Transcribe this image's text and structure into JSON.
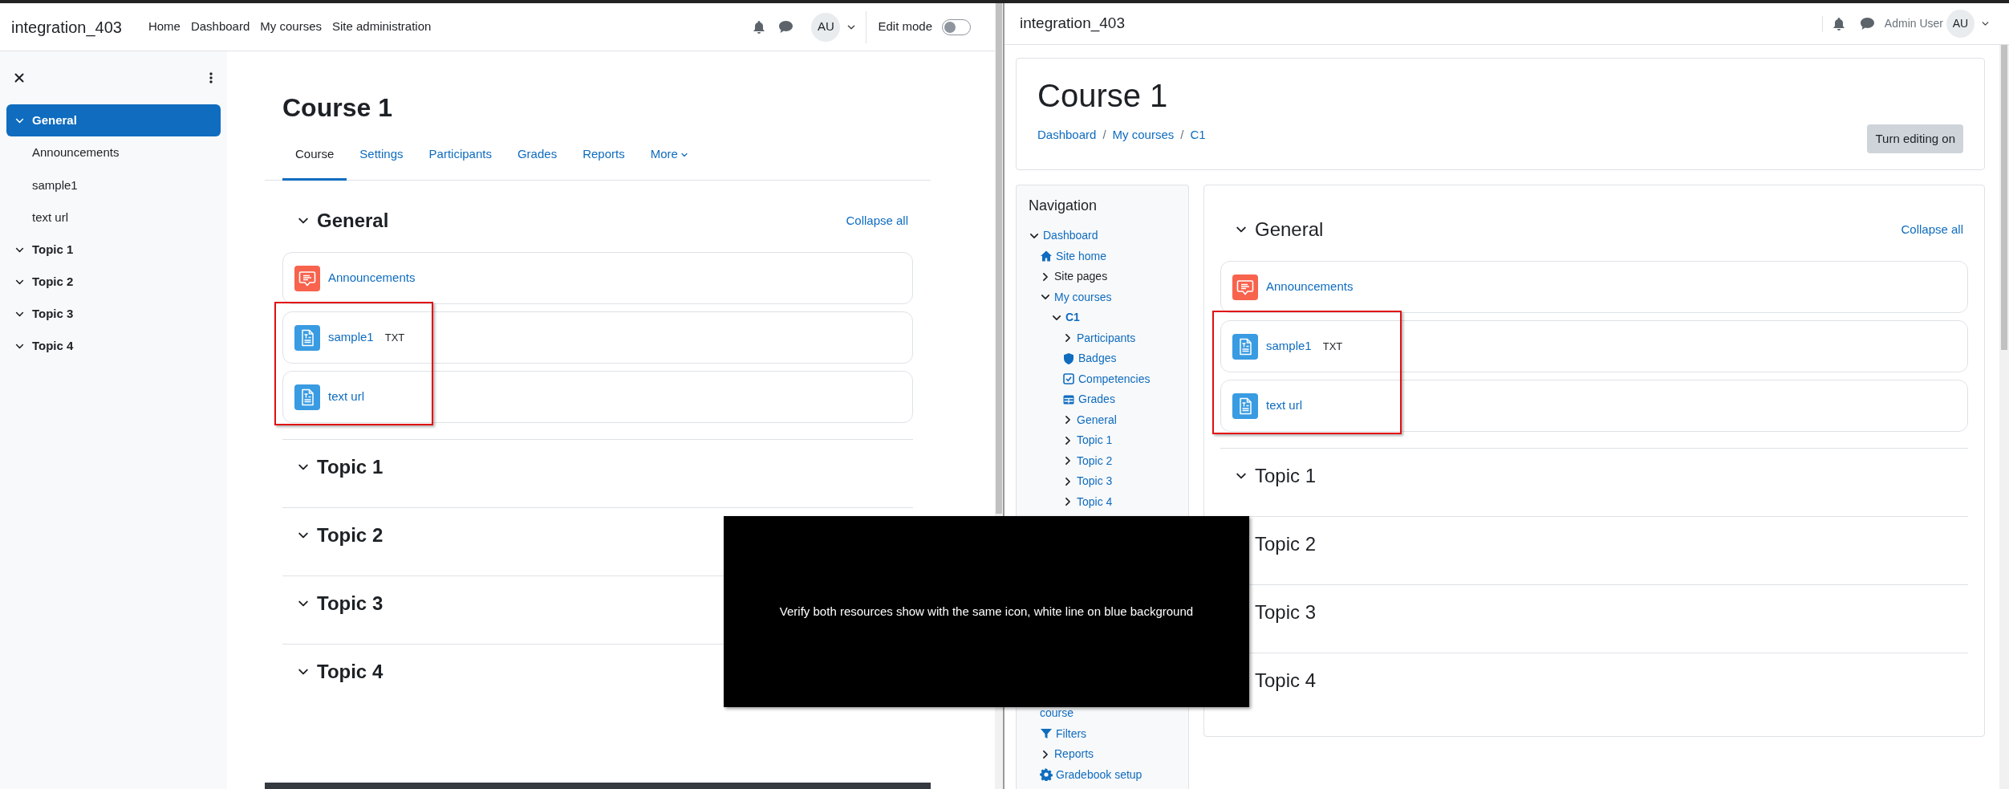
{
  "left": {
    "header": {
      "site_name": "integration_403",
      "nav": [
        {
          "label": "Home"
        },
        {
          "label": "Dashboard"
        },
        {
          "label": "My courses"
        },
        {
          "label": "Site administration"
        }
      ],
      "avatar": "AU",
      "edit_mode": {
        "label": "Edit mode",
        "on": false
      }
    },
    "course_index": {
      "sections": [
        {
          "title": "General",
          "selected": true,
          "expanded": true,
          "items": [
            "Announcements",
            "sample1",
            "text url"
          ]
        },
        {
          "title": "Topic 1",
          "selected": false,
          "expanded": true
        },
        {
          "title": "Topic 2",
          "selected": false,
          "expanded": true
        },
        {
          "title": "Topic 3",
          "selected": false,
          "expanded": true
        },
        {
          "title": "Topic 4",
          "selected": false,
          "expanded": true
        }
      ]
    },
    "course": {
      "title": "Course 1",
      "tabs": [
        {
          "label": "Course",
          "selected": true
        },
        {
          "label": "Settings",
          "selected": false
        },
        {
          "label": "Participants",
          "selected": false
        },
        {
          "label": "Grades",
          "selected": false
        },
        {
          "label": "Reports",
          "selected": false
        },
        {
          "label": "More",
          "selected": false,
          "kind": "menu"
        }
      ],
      "collapse_all": "Collapse all",
      "sections": [
        {
          "title": "General",
          "expanded": true,
          "activities": [
            {
              "name": "Announcements",
              "kind": "forum",
              "highlighted": false
            },
            {
              "name": "sample1",
              "kind": "file",
              "badge": "TXT",
              "highlighted": true
            },
            {
              "name": "text url",
              "kind": "file",
              "highlighted": true
            }
          ]
        },
        {
          "title": "Topic 1",
          "expanded": true
        },
        {
          "title": "Topic 2",
          "expanded": true
        },
        {
          "title": "Topic 3",
          "expanded": true
        },
        {
          "title": "Topic 4",
          "expanded": true
        }
      ]
    }
  },
  "right": {
    "header": {
      "site_name": "integration_403",
      "user_name": "Admin User",
      "avatar": "AU"
    },
    "course_header": {
      "title": "Course 1",
      "breadcrumb": [
        "Dashboard",
        "My courses",
        "C1"
      ],
      "breadcrumb_separator": "/",
      "button": "Turn editing on"
    },
    "navigation": {
      "title": "Navigation",
      "items": [
        {
          "label": "Dashboard",
          "kind": "branch",
          "expanded": true,
          "link": true,
          "current": false,
          "children": [
            {
              "label": "Site home",
              "kind": "home",
              "link": true,
              "current": false
            },
            {
              "label": "Site pages",
              "kind": "branch",
              "expanded": false,
              "link": false,
              "current": false
            },
            {
              "label": "My courses",
              "kind": "branch",
              "expanded": true,
              "link": true,
              "current": false,
              "children": [
                {
                  "label": "C1",
                  "kind": "branch",
                  "expanded": true,
                  "link": true,
                  "current": true,
                  "children": [
                    {
                      "label": "Participants",
                      "kind": "branch",
                      "expanded": false,
                      "link": true,
                      "current": false
                    },
                    {
                      "label": "Badges",
                      "kind": "badge",
                      "link": true,
                      "current": false
                    },
                    {
                      "label": "Competencies",
                      "kind": "checkbox",
                      "link": true,
                      "current": false
                    },
                    {
                      "label": "Grades",
                      "kind": "table",
                      "link": true,
                      "current": false
                    },
                    {
                      "label": "General",
                      "kind": "branch",
                      "expanded": false,
                      "link": true,
                      "current": false
                    },
                    {
                      "label": "Topic 1",
                      "kind": "branch",
                      "expanded": false,
                      "link": true,
                      "current": false
                    },
                    {
                      "label": "Topic 2",
                      "kind": "branch",
                      "expanded": false,
                      "link": true,
                      "current": false
                    },
                    {
                      "label": "Topic 3",
                      "kind": "branch",
                      "expanded": false,
                      "link": true,
                      "current": false
                    },
                    {
                      "label": "Topic 4",
                      "kind": "branch",
                      "expanded": false,
                      "link": true,
                      "current": false
                    }
                  ]
                }
              ]
            }
          ]
        }
      ],
      "lower_items": [
        {
          "label": "course",
          "kind": "text",
          "link": true,
          "current": false
        },
        {
          "label": "Filters",
          "kind": "filter",
          "link": true,
          "current": false
        },
        {
          "label": "Reports",
          "kind": "branch",
          "expanded": false,
          "link": true,
          "current": false
        },
        {
          "label": "Gradebook setup",
          "kind": "gear",
          "link": true,
          "current": false
        }
      ]
    },
    "course": {
      "collapse_all": "Collapse all",
      "sections": [
        {
          "title": "General",
          "expanded": true,
          "activities": [
            {
              "name": "Announcements",
              "kind": "forum",
              "highlighted": false
            },
            {
              "name": "sample1",
              "kind": "file",
              "badge": "TXT",
              "highlighted": true
            },
            {
              "name": "text url",
              "kind": "file",
              "highlighted": true
            }
          ]
        },
        {
          "title": "Topic 1",
          "expanded": true
        },
        {
          "title": "Topic 2"
        },
        {
          "title": "Topic 3"
        },
        {
          "title": "Topic 4"
        }
      ]
    }
  },
  "overlay": {
    "message": "Verify both resources show with the same icon, white line on blue background"
  }
}
